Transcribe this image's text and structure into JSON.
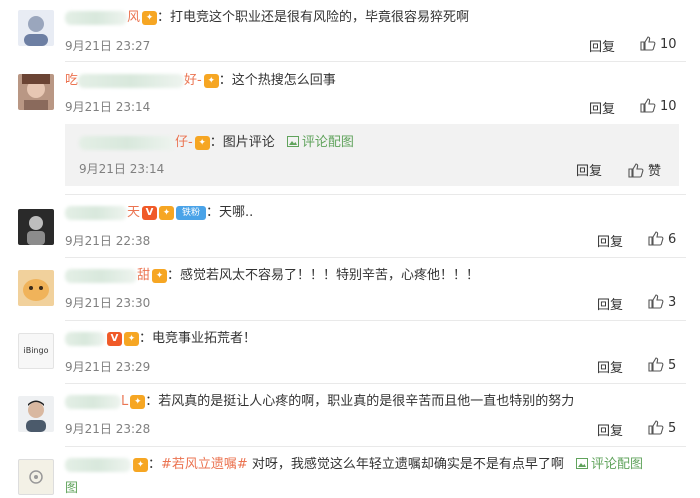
{
  "comments": [
    {
      "name": "风",
      "colon": "：",
      "text": "打电竞这个职业还是很有风险的，毕竟很容易猝死啊",
      "time": "9月21日 23:27",
      "reply": "回复",
      "likes": "10"
    },
    {
      "name_pre": "吃",
      "name": "好-",
      "colon": "：",
      "text": "这个热搜怎么回事",
      "time": "9月21日 23:14",
      "reply": "回复",
      "likes": "10"
    },
    {
      "name": "天",
      "colon": "：",
      "text": "天哪..",
      "badge_fan": "铁粉",
      "time": "9月21日 22:38",
      "reply": "回复",
      "likes": "6"
    },
    {
      "name": "甜",
      "colon": "：",
      "text": "感觉若风太不容易了！！！特别辛苦，心疼他！！！",
      "time": "9月21日 23:30",
      "reply": "回复",
      "likes": "3"
    },
    {
      "name": "",
      "colon": "：",
      "text": "电竞事业拓荒者！",
      "time": "9月21日 23:29",
      "reply": "回复",
      "likes": "5",
      "avatar_text": "iBingo"
    },
    {
      "name": "L",
      "colon": "：",
      "text": "若风真的是挺让人心疼的啊，职业真的是很辛苦而且他一直也特别的努力",
      "time": "9月21日 23:28",
      "reply": "回复",
      "likes": "5"
    },
    {
      "name": "",
      "colon": "：",
      "hashtag": "#若风立遗嘱#",
      "text": "对呀，我感觉这么年轻立遗嘱却确实是不是有点早了啊",
      "pic": "评论配图",
      "pic_tail": "图"
    }
  ],
  "subcomment": {
    "name": "仔-",
    "colon": "：",
    "text": "图片评论",
    "pic": "评论配图",
    "time": "9月21日 23:14",
    "reply": "回复",
    "like": "赞"
  },
  "badge_v": "V",
  "colors": {
    "name": "#eb7350",
    "time": "#808080",
    "link": "#60a35c",
    "fan": "#4aa3e8"
  }
}
